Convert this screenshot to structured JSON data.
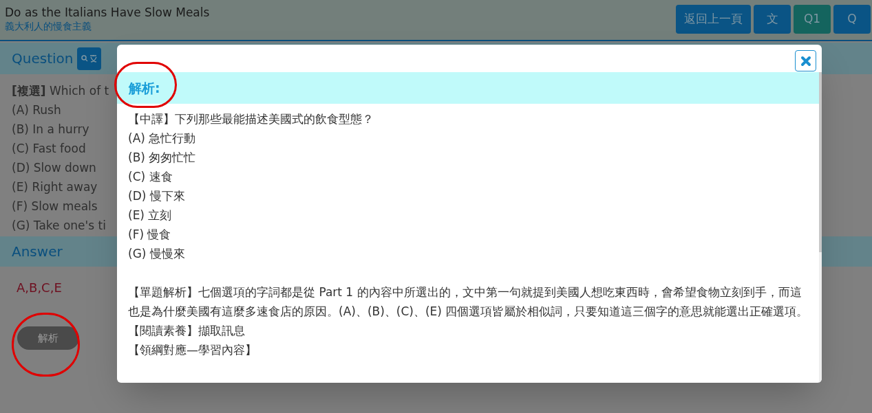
{
  "header": {
    "title": "Do as the Italians Have Slow Meals",
    "subtitle": "義大利人的慢食主義",
    "buttons": [
      {
        "label": "返回上一頁",
        "kind": "nav"
      },
      {
        "label": "文",
        "kind": "nav"
      },
      {
        "label": "Q1",
        "kind": "current"
      },
      {
        "label": "Q",
        "kind": "nav"
      }
    ]
  },
  "question": {
    "heading": "Question",
    "stem": "**[複選]** Which of t",
    "options": [
      "(A) Rush",
      "(B) In a hurry",
      "(C) Fast food",
      "(D) Slow down",
      "(E) Right away",
      "(F) Slow meals",
      "(G) Take one's ti"
    ]
  },
  "answer": {
    "heading": "Answer",
    "value": "A,B,C,E",
    "explain_button": "解析"
  },
  "modal": {
    "heading": "解析:",
    "translation": [
      "【中譯】下列那些最能描述美國式的飲食型態？",
      "(A) 急忙行動",
      "(B) 匆匆忙忙",
      "(C) 速食",
      "(D) 慢下來",
      "(E) 立刻",
      "(F) 慢食",
      "(G) 慢慢來"
    ],
    "analysis": [
      "【單題解析】七個選項的字詞都是從 Part 1 的內容中所選出的，文中第一句就提到美國人想吃東西時，會希望食物立刻到手，而這也是為什麼美國有這麼多速食店的原因。(A)、(B)、(C)、(E) 四個選項皆屬於相似詞，只要知道這三個字的意思就能選出正確選項。",
      "【閱讀素養】擷取訊息",
      "【領綱對應—學習內容】"
    ]
  }
}
